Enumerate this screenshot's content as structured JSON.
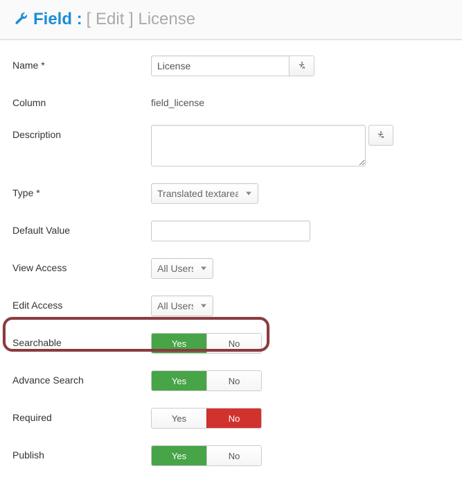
{
  "title": {
    "icon": "wrench-icon",
    "blue": "Field :",
    "gray": "[ Edit ] License"
  },
  "labels": {
    "name": "Name *",
    "column": "Column",
    "description": "Description",
    "type": "Type *",
    "default_value": "Default Value",
    "view_access": "View Access",
    "edit_access": "Edit Access",
    "searchable": "Searchable",
    "advance_search": "Advance Search",
    "required": "Required",
    "publish": "Publish"
  },
  "values": {
    "name": "License",
    "column": "field_license",
    "description": "",
    "type_selected": "Translated textarea",
    "default_value": "",
    "view_access_selected": "All Users",
    "edit_access_selected": "All Users"
  },
  "toggles": {
    "yes": "Yes",
    "no": "No",
    "searchable": "yes",
    "advance_search": "yes",
    "required": "no",
    "publish": "yes"
  },
  "colors": {
    "blue": "#1a8ed6",
    "green": "#47a447",
    "red": "#d2322d",
    "highlight": "#8a3b3e"
  }
}
